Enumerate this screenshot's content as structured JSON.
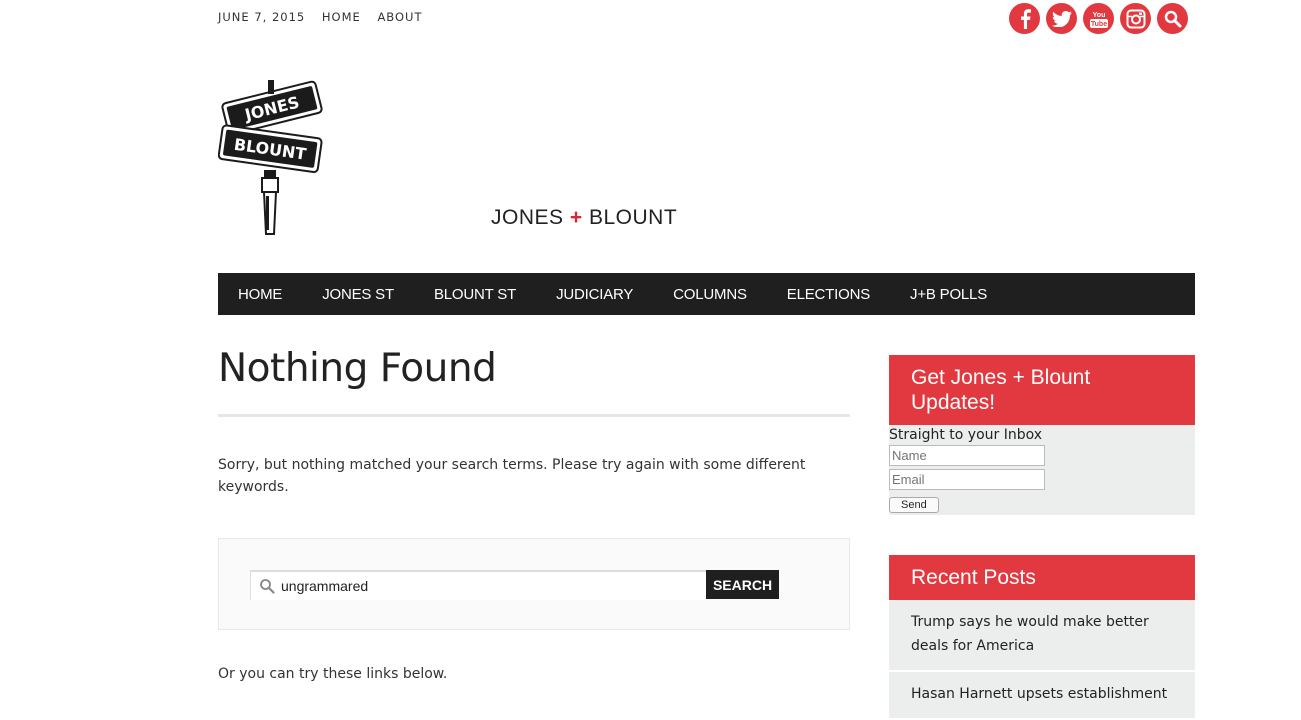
{
  "topbar": {
    "date": "JUNE 7, 2015",
    "links": [
      "HOME",
      "ABOUT"
    ]
  },
  "social": {
    "icons": [
      "facebook-icon",
      "twitter-icon",
      "youtube-icon",
      "instagram-icon",
      "search-icon"
    ],
    "color": "#e2383f"
  },
  "logo": {
    "top_sign": "JONES",
    "bottom_sign": "BLOUNT"
  },
  "site": {
    "title_left": "JONES",
    "title_plus": "+",
    "title_right": "BLOUNT",
    "accent": "#d9282f"
  },
  "nav": {
    "items": [
      "HOME",
      "JONES ST",
      "BLOUNT ST",
      "JUDICIARY",
      "COLUMNS",
      "ELECTIONS",
      "J+B POLLS"
    ]
  },
  "main": {
    "heading": "Nothing Found",
    "message": "Sorry, but nothing matched your search terms. Please try again with some different keywords.",
    "search_value": "ungrammared",
    "search_button": "SEARCH",
    "links_intro": "Or you can try these links below."
  },
  "newsletter": {
    "title": "Get Jones + Blount Updates!",
    "subtitle": "Straight to your Inbox",
    "name_placeholder": "Name",
    "email_placeholder": "Email",
    "send_label": "Send"
  },
  "recent": {
    "title": "Recent Posts",
    "posts": [
      "Trump says he would make better deals for America",
      "Hasan Harnett upsets establishment"
    ]
  }
}
